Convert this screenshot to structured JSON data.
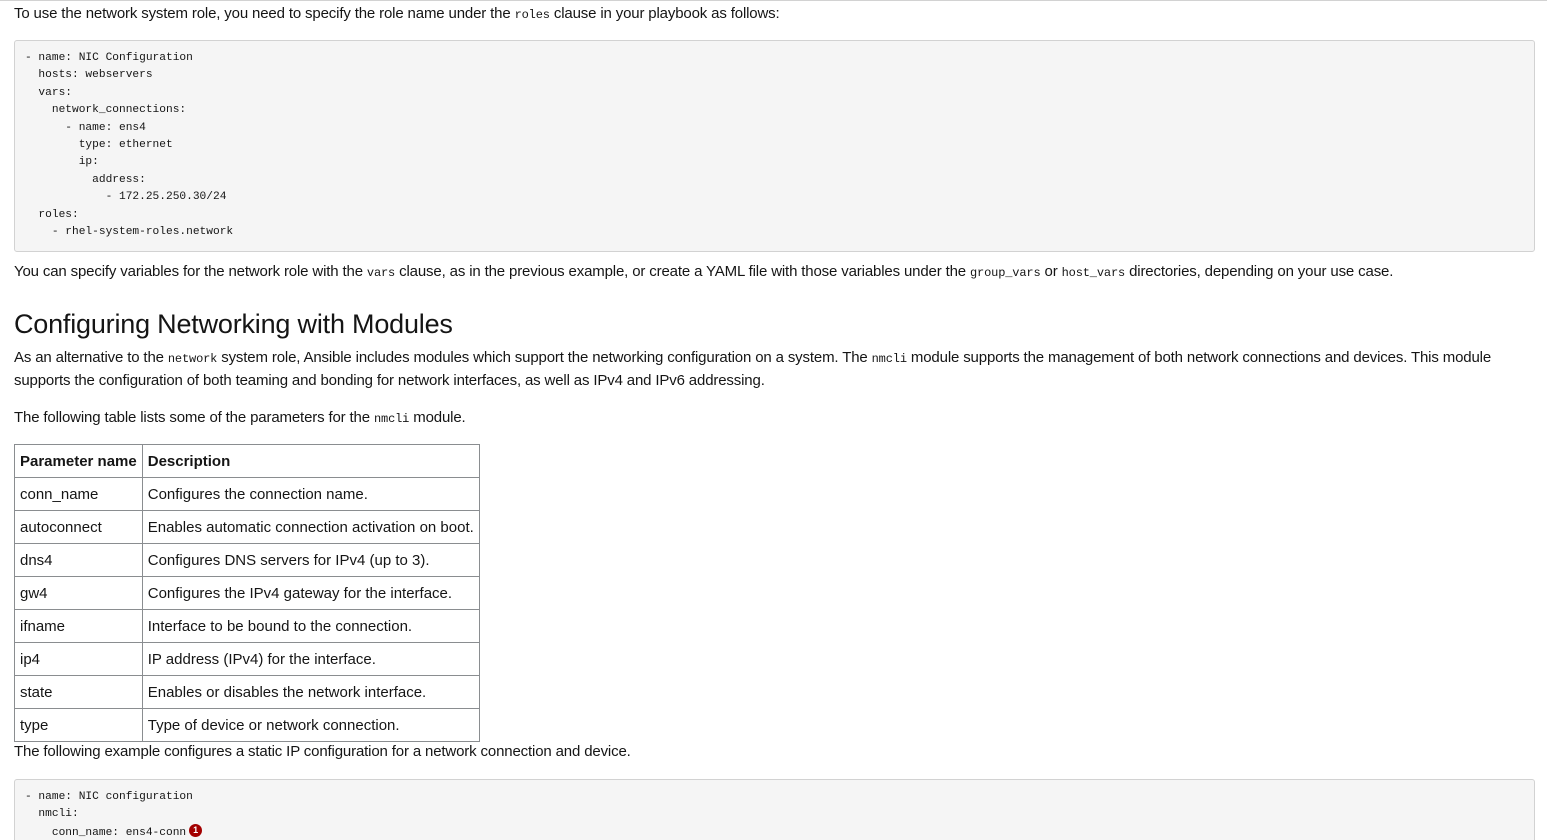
{
  "intro": {
    "before": "To use the network system role, you need to specify the role name under the ",
    "code": "roles",
    "after": " clause in your playbook as follows:"
  },
  "code_block_1": "- name: NIC Configuration\n  hosts: webservers\n  vars:\n    network_connections:\n      - name: ens4\n        type: ethernet\n        ip:\n          address:\n            - 172.25.250.30/24\n  roles:\n    - rhel-system-roles.network",
  "vars_para": {
    "part1": "You can specify variables for the network role with the ",
    "code1": "vars",
    "part2": " clause, as in the previous example, or create a YAML file with those variables under the ",
    "code2": "group_vars",
    "part3": " or ",
    "code3": "host_vars",
    "part4": " directories, depending on your use case."
  },
  "section_title": "Configuring Networking with Modules",
  "modules_para": {
    "part1": "As an alternative to the ",
    "code1": "network",
    "part2": " system role, Ansible includes modules which support the networking configuration on a system. The ",
    "code2": "nmcli",
    "part3": " module supports the management of both network connections and devices. This module supports the configuration of both teaming and bonding for network interfaces, as well as IPv4 and IPv6 addressing."
  },
  "table_intro": {
    "before": "The following table lists some of the parameters for the ",
    "code": "nmcli",
    "after": " module."
  },
  "table": {
    "headers": [
      "Parameter name",
      "Description"
    ],
    "rows": [
      [
        "conn_name",
        "Configures the connection name."
      ],
      [
        "autoconnect",
        "Enables automatic connection activation on boot."
      ],
      [
        "dns4",
        "Configures DNS servers for IPv4 (up to 3)."
      ],
      [
        "gw4",
        "Configures the IPv4 gateway for the interface."
      ],
      [
        "ifname",
        "Interface to be bound to the connection."
      ],
      [
        "ip4",
        "IP address (IPv4) for the interface."
      ],
      [
        "state",
        "Enables or disables the network interface."
      ],
      [
        "type",
        "Type of device or network connection."
      ]
    ]
  },
  "example_intro": "The following example configures a static IP configuration for a network connection and device.",
  "code_block_2": {
    "lines": [
      "- name: NIC configuration",
      "  nmcli:",
      "    conn_name: ens4-conn"
    ],
    "callout": "1"
  }
}
